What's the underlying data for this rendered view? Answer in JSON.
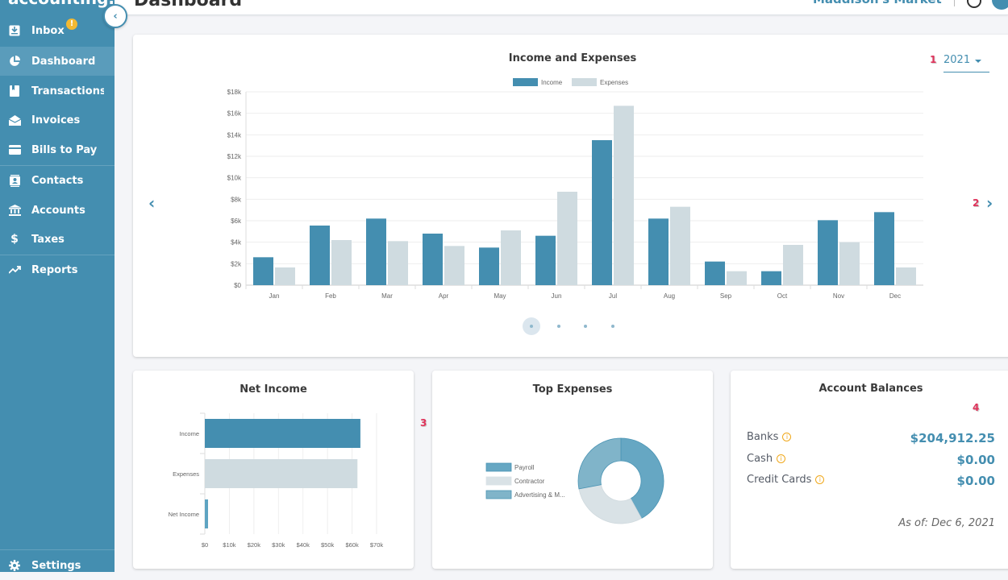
{
  "sidebar": {
    "brand": "accounting.",
    "collapse_icon": "chevron-left-icon",
    "items": [
      {
        "label": "Inbox",
        "icon": "inbox-icon",
        "badge": "!"
      },
      {
        "label": "Dashboard",
        "icon": "pie-chart-icon",
        "active": true
      },
      {
        "label": "Transactions",
        "icon": "book-icon"
      },
      {
        "label": "Invoices",
        "icon": "envelope-open-icon"
      },
      {
        "label": "Bills to Pay",
        "icon": "credit-card-icon"
      },
      {
        "label": "Contacts",
        "icon": "contact-card-icon"
      },
      {
        "label": "Accounts",
        "icon": "bank-icon"
      },
      {
        "label": "Taxes",
        "icon": "dollar-icon"
      },
      {
        "label": "Reports",
        "icon": "trending-up-icon"
      }
    ],
    "settings": {
      "label": "Settings",
      "icon": "gear-icon"
    }
  },
  "header": {
    "title": "Dashboard",
    "company": "Maddison's Market",
    "help_icon": "help-icon",
    "avatar": "avatar"
  },
  "income_expenses": {
    "title": "Income and Expenses",
    "year_selected": "2021",
    "markers": [
      "1",
      "2",
      "3",
      "4"
    ],
    "pagination": {
      "count": 4,
      "active": 0
    }
  },
  "colors": {
    "income": "#448eb0",
    "expenses": "#cfdbe0",
    "accent": "#448eb0",
    "sidebar": "#448eb0",
    "warning": "#f0a81b",
    "marker": "#e0335b"
  },
  "chart_data": [
    {
      "type": "bar",
      "title": "Income and Expenses",
      "categories": [
        "Jan",
        "Feb",
        "Mar",
        "Apr",
        "May",
        "Jun",
        "Jul",
        "Aug",
        "Sep",
        "Oct",
        "Nov",
        "Dec"
      ],
      "series": [
        {
          "name": "Income",
          "values": [
            2600,
            5550,
            6200,
            4800,
            3500,
            4600,
            13500,
            6200,
            2200,
            1300,
            6050,
            6800
          ]
        },
        {
          "name": "Expenses",
          "values": [
            1650,
            4200,
            4100,
            3650,
            5100,
            8700,
            16700,
            7300,
            1300,
            3750,
            4000,
            1650
          ]
        }
      ],
      "yticks": [
        "$0",
        "$2k",
        "$4k",
        "$6k",
        "$8k",
        "$10k",
        "$12k",
        "$14k",
        "$16k",
        "$18k"
      ],
      "ylim": [
        0,
        18000
      ],
      "legend": "top-center",
      "grid": true,
      "xlabel": "",
      "ylabel": ""
    },
    {
      "type": "bar",
      "orientation": "horizontal",
      "title": "Net Income",
      "categories": [
        "Income",
        "Expenses",
        "Net Income"
      ],
      "values": [
        63400,
        62200,
        1200
      ],
      "xticks": [
        "$0",
        "$10k",
        "$20k",
        "$30k",
        "$40k",
        "$50k",
        "$60k",
        "$70k"
      ],
      "xlim": [
        0,
        70000
      ],
      "grid": true
    },
    {
      "type": "pie",
      "variant": "donut",
      "title": "Top Expenses",
      "labels": [
        "Payroll",
        "Contractor",
        "Advertising & M..."
      ],
      "values": [
        42,
        30,
        28
      ],
      "legend": "left"
    }
  ],
  "account_balances": {
    "title": "Account Balances",
    "rows": [
      {
        "label": "Banks",
        "value": "$204,912.25"
      },
      {
        "label": "Cash",
        "value": "$0.00"
      },
      {
        "label": "Credit Cards",
        "value": "$0.00"
      }
    ],
    "as_of": "As of: Dec 6, 2021"
  }
}
